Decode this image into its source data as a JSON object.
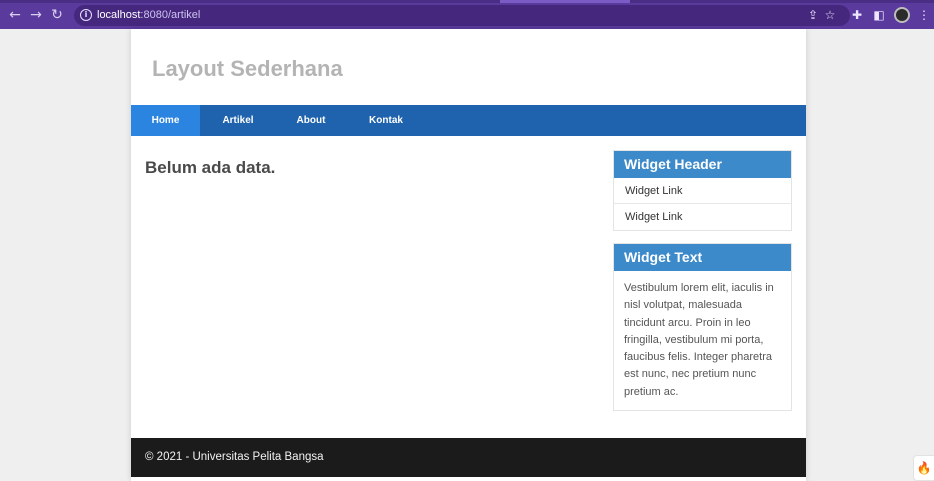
{
  "browser": {
    "url_host": "localhost",
    "url_path": ":8080/artikel",
    "icons": [
      "back-arrow-icon",
      "forward-arrow-icon",
      "reload-icon",
      "site-info-icon",
      "share-icon",
      "bookmark-star-icon",
      "extensions-icon",
      "side-panel-icon",
      "profile-avatar",
      "menu-icon"
    ]
  },
  "site": {
    "title": "Layout Sederhana"
  },
  "nav": {
    "items": [
      {
        "label": "Home",
        "active": true
      },
      {
        "label": "Artikel",
        "active": false
      },
      {
        "label": "About",
        "active": false
      },
      {
        "label": "Kontak",
        "active": false
      }
    ]
  },
  "main": {
    "heading": "Belum ada data."
  },
  "sidebar": {
    "widget1": {
      "header": "Widget Header",
      "links": [
        "Widget Link",
        "Widget Link"
      ]
    },
    "widget2": {
      "header": "Widget Text",
      "text": "Vestibulum lorem elit, iaculis in nisl volutpat, malesuada tincidunt arcu. Proin in leo fringilla, vestibulum mi porta, faucibus felis. Integer pharetra est nunc, nec pretium nunc pretium ac."
    }
  },
  "footer": {
    "text": "© 2021 - Universitas Pelita Bangsa"
  },
  "colors": {
    "chrome": "#5b3a9e",
    "navbar": "#1f62ad",
    "nav_active": "#2b84e0",
    "widget_header": "#3d8acb",
    "footer": "#1b1b1b"
  }
}
